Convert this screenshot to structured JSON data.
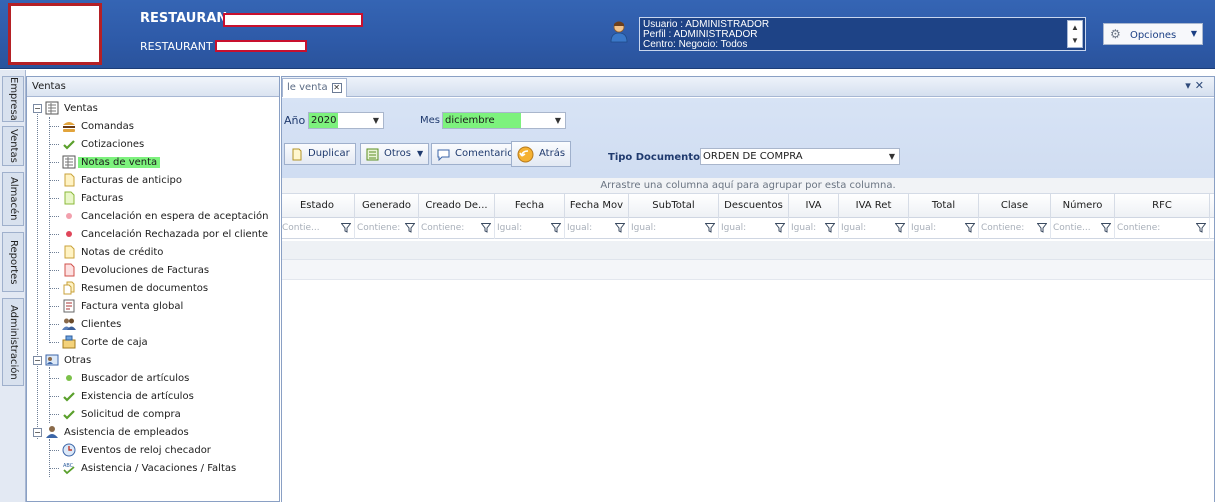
{
  "header": {
    "company_name": "RESTAURAN",
    "company_sub": "RESTAURANT",
    "user_lines": [
      "Usuario : ADMINISTRADOR",
      "Perfil : ADMINISTRADOR",
      "Centro: Negocio: Todos"
    ],
    "options_label": "Opciones",
    "brand_color": "#2e5aa8"
  },
  "vertical_tabs": [
    "Empresa",
    "Ventas",
    "Almacén",
    "Reportes",
    "Administración"
  ],
  "tree_panel": {
    "title": "Ventas",
    "groups": [
      {
        "label": "Ventas",
        "items": [
          "Comandas",
          "Cotizaciones",
          "Notas de venta",
          "Facturas de anticipo",
          "Facturas",
          "Cancelación en espera de aceptación",
          "Cancelación Rechazada por el cliente",
          "Notas de crédito",
          "Devoluciones de Facturas",
          "Resumen de documentos",
          "Factura venta global",
          "Clientes",
          "Corte de caja"
        ]
      },
      {
        "label": "Otras",
        "items": [
          "Buscador de artículos",
          "Existencia de artículos",
          "Solicitud de compra"
        ]
      },
      {
        "label": "Asistencia de empleados",
        "items": [
          "Eventos de reloj checador",
          "Asistencia / Vacaciones / Faltas"
        ]
      }
    ],
    "selected_item": "Notas de venta"
  },
  "content": {
    "tab_label": "le venta",
    "filters": {
      "year_label": "Año",
      "year_value": "2020",
      "month_label": "Mes",
      "month_value": "diciembre",
      "doc_type_label": "Tipo Documento",
      "doc_type_value": "ORDEN DE COMPRA"
    },
    "toolbar": {
      "duplicate": "Duplicar",
      "others": "Otros",
      "comment": "Comentario",
      "back": "Atrás"
    },
    "grid": {
      "group_hint": "Arrastre una columna aquí para agrupar por esta columna.",
      "columns": [
        "Estado",
        "Generado",
        "Creado De...",
        "Fecha Emisión",
        "Fecha Mov",
        "SubTotal",
        "Descuentos",
        "IVA",
        "IVA Ret",
        "Total",
        "Clase",
        "Número",
        "RFC"
      ],
      "filters": [
        "Contie...",
        "Contiene:",
        "Contiene:",
        "Igual:",
        "Igual:",
        "Igual:",
        "Igual:",
        "Igual:",
        "Igual:",
        "Igual:",
        "Contiene:",
        "Contie...",
        "Contiene:"
      ]
    }
  }
}
